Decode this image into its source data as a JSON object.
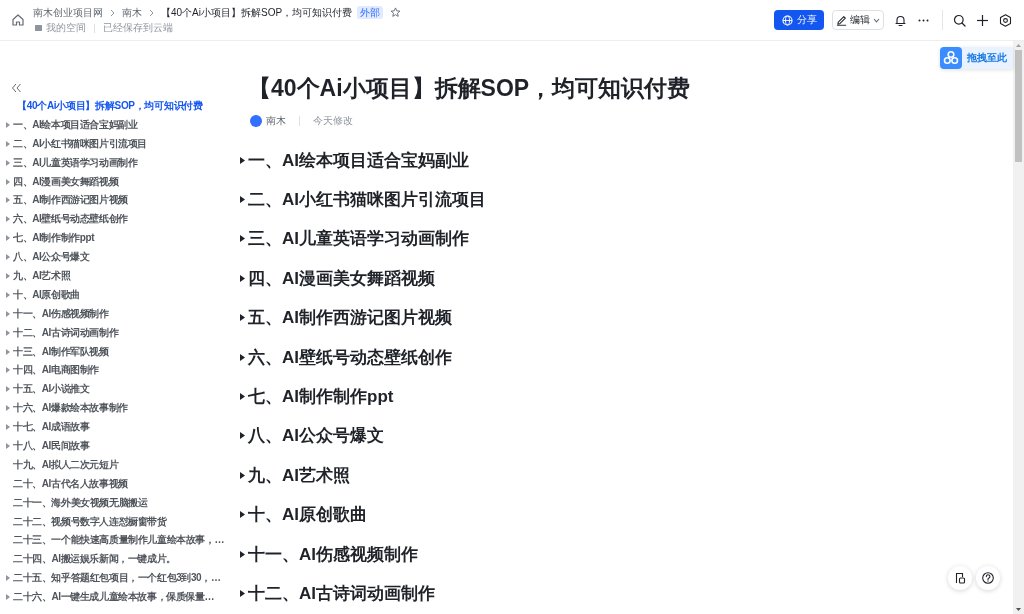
{
  "topbar": {
    "breadcrumb": [
      "南木创业项目网",
      "南木",
      "【40个Ai小项目】拆解SOP，均可知识付费"
    ],
    "tag": "外部",
    "starred": false,
    "location": "我的空间",
    "save_status": "已经保存到云端",
    "share_button": "分享",
    "edit_button": "编辑"
  },
  "drop_widget": {
    "label": "拖拽至此"
  },
  "toc": {
    "title": {
      "text": "【40个Ai小项目】拆解SOP，均可知识付费",
      "selected": true
    },
    "items": [
      {
        "text": "一、AI绘本项目适合宝妈副业",
        "expandable": true,
        "selected": false
      },
      {
        "text": "二、AI小红书猫咪图片引流项目",
        "expandable": true,
        "selected": false
      },
      {
        "text": "三、AI儿童英语学习动画制作",
        "expandable": true,
        "selected": false
      },
      {
        "text": "四、AI漫画美女舞蹈视频",
        "expandable": true,
        "selected": false
      },
      {
        "text": "五、AI制作西游记图片视频",
        "expandable": true,
        "selected": false
      },
      {
        "text": "六、AI壁纸号动态壁纸创作",
        "expandable": true,
        "selected": false
      },
      {
        "text": "七、AI制作制作ppt",
        "expandable": true,
        "selected": false
      },
      {
        "text": "八、AI公众号爆文",
        "expandable": true,
        "selected": false
      },
      {
        "text": "九、AI艺术照",
        "expandable": true,
        "selected": false
      },
      {
        "text": "十、AI原创歌曲",
        "expandable": true,
        "selected": false
      },
      {
        "text": "十一、AI伤感视频制作",
        "expandable": true,
        "selected": false
      },
      {
        "text": "十二、AI古诗词动画制作",
        "expandable": true,
        "selected": false
      },
      {
        "text": "十三、AI制作军队视频",
        "expandable": true,
        "selected": false
      },
      {
        "text": "十四、AI电商图制作",
        "expandable": true,
        "selected": false
      },
      {
        "text": "十五、AI小说推文",
        "expandable": true,
        "selected": false
      },
      {
        "text": "十六、AI爆款绘本故事制作",
        "expandable": true,
        "selected": false
      },
      {
        "text": "十七、AI成语故事",
        "expandable": true,
        "selected": false
      },
      {
        "text": "十八、AI民间故事",
        "expandable": true,
        "selected": false
      },
      {
        "text": "十九、AI拟人二次元短片",
        "expandable": false,
        "selected": false
      },
      {
        "text": "二十、AI古代名人故事视频",
        "expandable": false,
        "selected": false
      },
      {
        "text": "二十一、海外美女视频无脑搬运",
        "expandable": false,
        "selected": false
      },
      {
        "text": "二十二、视频号数字人连怼橱窗带货",
        "expandable": false,
        "selected": false
      },
      {
        "text": "二十三、一个能快速高质量制作儿童绘本故事，…",
        "expandable": false,
        "selected": false
      },
      {
        "text": "二十四、AI搬运娱乐新闻，一键成片。",
        "expandable": false,
        "selected": false
      },
      {
        "text": "二十五、知乎答题红包项目，一个红包3到30，…",
        "expandable": true,
        "selected": false
      },
      {
        "text": "二十六、AI一键生成儿童绘本故事，保质保量…",
        "expandable": true,
        "selected": false
      }
    ]
  },
  "document": {
    "title": "【40个Ai小项目】拆解SOP，均可知识付费",
    "author": "南木",
    "modified": "今天修改",
    "headings": [
      {
        "text": "一、AI绘本项目适合宝妈副业",
        "expandable": true
      },
      {
        "text": "二、AI小红书猫咪图片引流项目",
        "expandable": true
      },
      {
        "text": "三、AI儿童英语学习动画制作",
        "expandable": true
      },
      {
        "text": "四、AI漫画美女舞蹈视频",
        "expandable": true
      },
      {
        "text": "五、AI制作西游记图片视频",
        "expandable": true
      },
      {
        "text": "六、AI壁纸号动态壁纸创作",
        "expandable": true
      },
      {
        "text": "七、AI制作制作ppt",
        "expandable": true
      },
      {
        "text": "八、AI公众号爆文",
        "expandable": true
      },
      {
        "text": "九、AI艺术照",
        "expandable": true
      },
      {
        "text": "十、AI原创歌曲",
        "expandable": true
      },
      {
        "text": "十一、AI伤感视频制作",
        "expandable": true
      },
      {
        "text": "十二、AI古诗词动画制作",
        "expandable": true
      }
    ]
  }
}
